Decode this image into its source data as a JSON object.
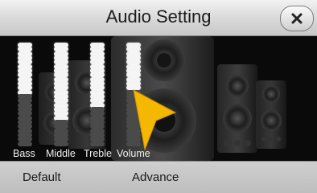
{
  "header": {
    "title": "Audio Setting",
    "close_icon": "close-x-icon"
  },
  "sliders": [
    {
      "label": "Bass",
      "level": 12,
      "total": 24
    },
    {
      "label": "Middle",
      "level": 18,
      "total": 24
    },
    {
      "label": "Treble",
      "level": 15,
      "total": 24
    },
    {
      "label": "Volume",
      "level": 11,
      "total": 24
    }
  ],
  "footer": {
    "default_label": "Default",
    "advance_label": "Advance"
  },
  "colors": {
    "segment_on": "#f4f4f4",
    "segment_off": "#4a4a4a",
    "cursor": "#f5b800"
  }
}
